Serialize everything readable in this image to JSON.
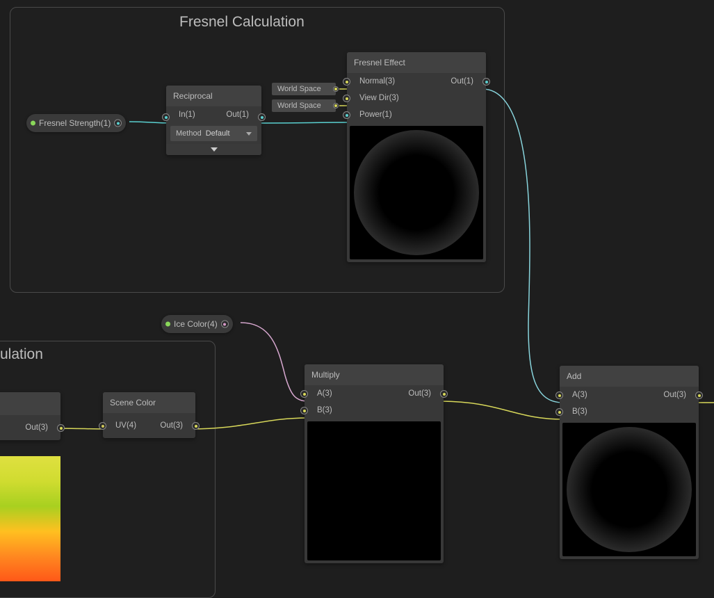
{
  "groups": {
    "fresnel": {
      "title": "Fresnel Calculation"
    },
    "partial": {
      "title": "ulation"
    }
  },
  "pills": {
    "fresnelStrength": {
      "label": "Fresnel Strength(1)"
    },
    "iceColor": {
      "label": "Ice Color(4)"
    }
  },
  "tags": {
    "worldSpace1": {
      "label": "World Space"
    },
    "worldSpace2": {
      "label": "World Space"
    }
  },
  "nodes": {
    "reciprocal": {
      "title": "Reciprocal",
      "in": "In(1)",
      "out": "Out(1)",
      "methodLabel": "Method",
      "methodValue": "Default"
    },
    "fresnelEffect": {
      "title": "Fresnel Effect",
      "normal": "Normal(3)",
      "viewDir": "View Dir(3)",
      "power": "Power(1)",
      "out": "Out(1)"
    },
    "sceneColor": {
      "title": "Scene Color",
      "uv": "UV(4)",
      "out": "Out(3)"
    },
    "multiply": {
      "title": "Multiply",
      "a": "A(3)",
      "b": "B(3)",
      "out": "Out(3)"
    },
    "add": {
      "title": "Add",
      "a": "A(3)",
      "b": "B(3)",
      "out": "Out(3)"
    },
    "partialOut": {
      "out": "Out(3)"
    }
  }
}
